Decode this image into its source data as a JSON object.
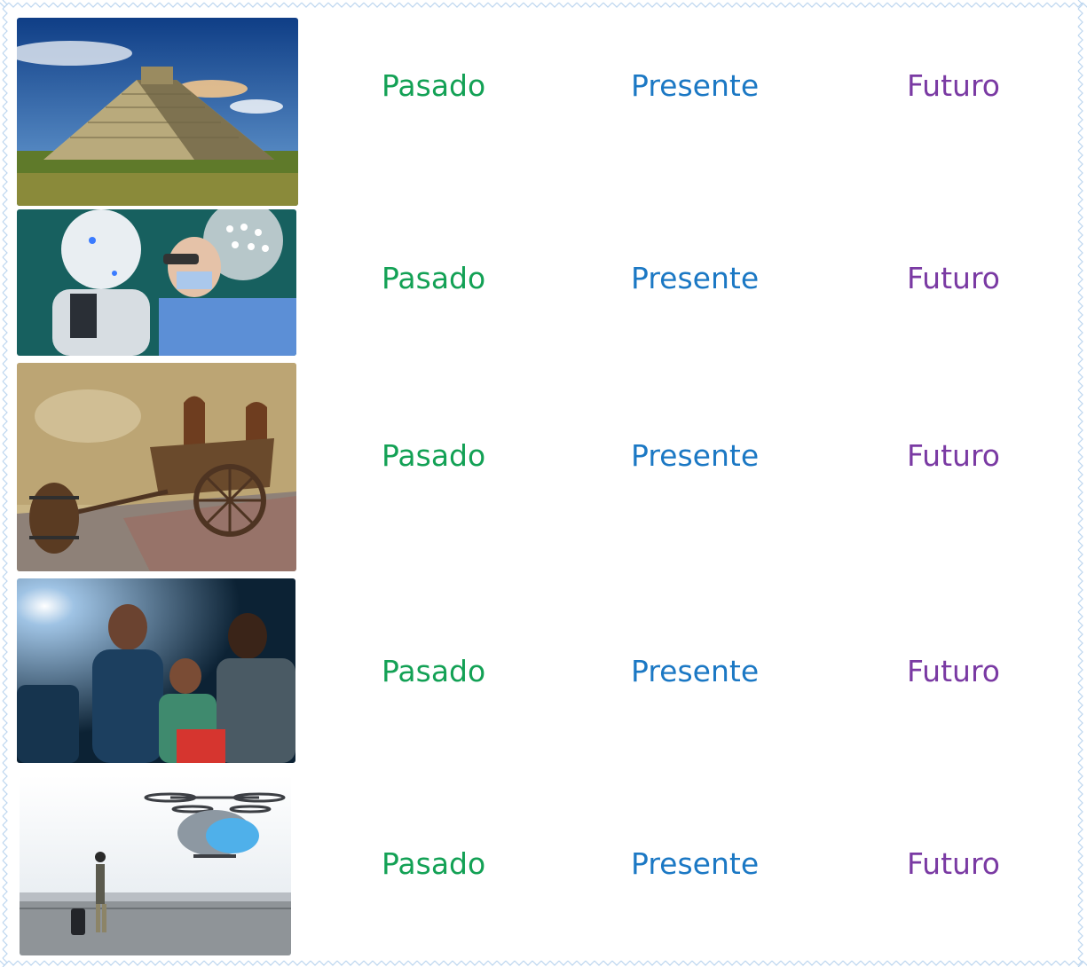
{
  "colors": {
    "pasado": "#13a155",
    "presente": "#1b78c4",
    "futuro": "#7a3aa3",
    "border": "#bcd6ef"
  },
  "worksheet": {
    "rows": [
      {
        "image": "pyramid-photo",
        "options": {
          "pasado": "Pasado",
          "presente": "Presente",
          "futuro": "Futuro"
        }
      },
      {
        "image": "robot-surgeon-photo",
        "options": {
          "pasado": "Pasado",
          "presente": "Presente",
          "futuro": "Futuro"
        }
      },
      {
        "image": "old-cart-photo",
        "options": {
          "pasado": "Pasado",
          "presente": "Presente",
          "futuro": "Futuro"
        }
      },
      {
        "image": "cinema-family-photo",
        "options": {
          "pasado": "Pasado",
          "presente": "Presente",
          "futuro": "Futuro"
        }
      },
      {
        "image": "passenger-drone-photo",
        "options": {
          "pasado": "Pasado",
          "presente": "Presente",
          "futuro": "Futuro"
        }
      }
    ]
  }
}
